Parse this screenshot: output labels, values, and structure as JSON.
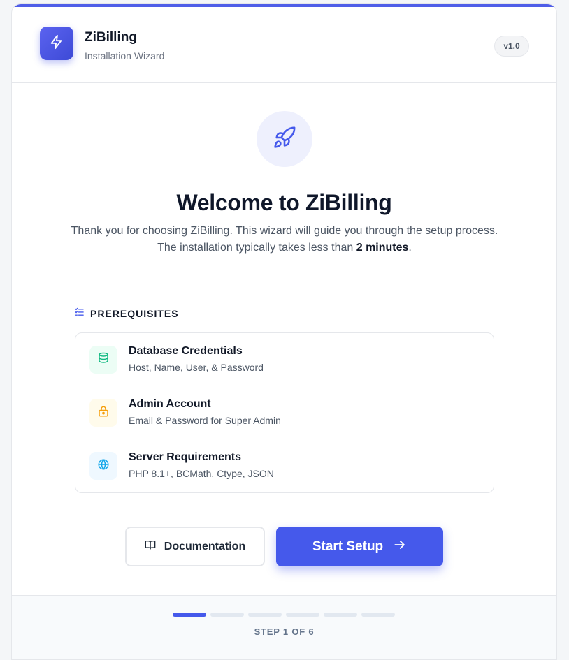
{
  "header": {
    "brand_name": "ZiBilling",
    "brand_subtitle": "Installation Wizard",
    "version": "v1.0",
    "logo_icon": "lightning-bolt-icon"
  },
  "hero": {
    "icon": "rocket-icon",
    "title": "Welcome to ZiBilling",
    "intro_line1": "Thank you for choosing ZiBilling. This wizard will guide you through the setup process.",
    "intro_line2_prefix": "The installation typically takes less than ",
    "intro_line2_bold": "2 minutes",
    "intro_line2_suffix": "."
  },
  "prerequisites": {
    "heading": "PREREQUISITES",
    "heading_icon": "list-check-icon",
    "items": [
      {
        "title": "Database Credentials",
        "description": "Host, Name, User, & Password",
        "icon": "database-icon",
        "color": "#10b981"
      },
      {
        "title": "Admin Account",
        "description": "Email & Password for Super Admin",
        "icon": "lock-icon",
        "color": "#f59e0b"
      },
      {
        "title": "Server Requirements",
        "description": "PHP 8.1+, BCMath, Ctype, JSON",
        "icon": "globe-icon",
        "color": "#0ea5e9"
      }
    ]
  },
  "actions": {
    "docs_label": "Documentation",
    "docs_icon": "book-open-icon",
    "start_label": "Start Setup",
    "start_icon": "arrow-right-icon"
  },
  "progress": {
    "current_step": 1,
    "total_steps": 6,
    "label": "STEP 1 OF 6"
  },
  "colors": {
    "accent": "#4559eb",
    "card_background": "#ffffff",
    "page_background": "#f4f6f8"
  }
}
